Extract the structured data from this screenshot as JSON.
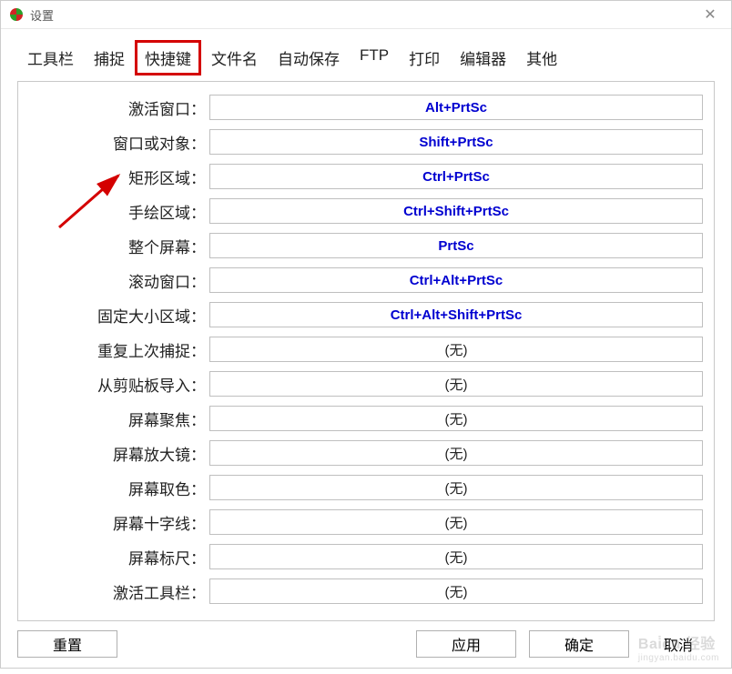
{
  "window": {
    "title": "设置"
  },
  "tabs": [
    "工具栏",
    "捕捉",
    "快捷键",
    "文件名",
    "自动保存",
    "FTP",
    "打印",
    "编辑器",
    "其他"
  ],
  "active_tab_index": 2,
  "rows": [
    {
      "label": "激活窗口：",
      "value": "Alt+PrtSc",
      "assigned": true
    },
    {
      "label": "窗口或对象：",
      "value": "Shift+PrtSc",
      "assigned": true
    },
    {
      "label": "矩形区域：",
      "value": "Ctrl+PrtSc",
      "assigned": true
    },
    {
      "label": "手绘区域：",
      "value": "Ctrl+Shift+PrtSc",
      "assigned": true
    },
    {
      "label": "整个屏幕：",
      "value": "PrtSc",
      "assigned": true
    },
    {
      "label": "滚动窗口：",
      "value": "Ctrl+Alt+PrtSc",
      "assigned": true
    },
    {
      "label": "固定大小区域：",
      "value": "Ctrl+Alt+Shift+PrtSc",
      "assigned": true
    },
    {
      "label": "重复上次捕捉：",
      "value": "(无)",
      "assigned": false
    },
    {
      "label": "从剪贴板导入：",
      "value": "(无)",
      "assigned": false
    },
    {
      "label": "屏幕聚焦：",
      "value": "(无)",
      "assigned": false
    },
    {
      "label": "屏幕放大镜：",
      "value": "(无)",
      "assigned": false
    },
    {
      "label": "屏幕取色：",
      "value": "(无)",
      "assigned": false
    },
    {
      "label": "屏幕十字线：",
      "value": "(无)",
      "assigned": false
    },
    {
      "label": "屏幕标尺：",
      "value": "(无)",
      "assigned": false
    },
    {
      "label": "激活工具栏：",
      "value": "(无)",
      "assigned": false
    }
  ],
  "buttons": {
    "reset": "重置",
    "apply": "应用",
    "ok": "确定",
    "cancel": "取消"
  },
  "watermark": {
    "main": "Bai̇du 经验",
    "sub": "jingyan.baidu.com"
  }
}
